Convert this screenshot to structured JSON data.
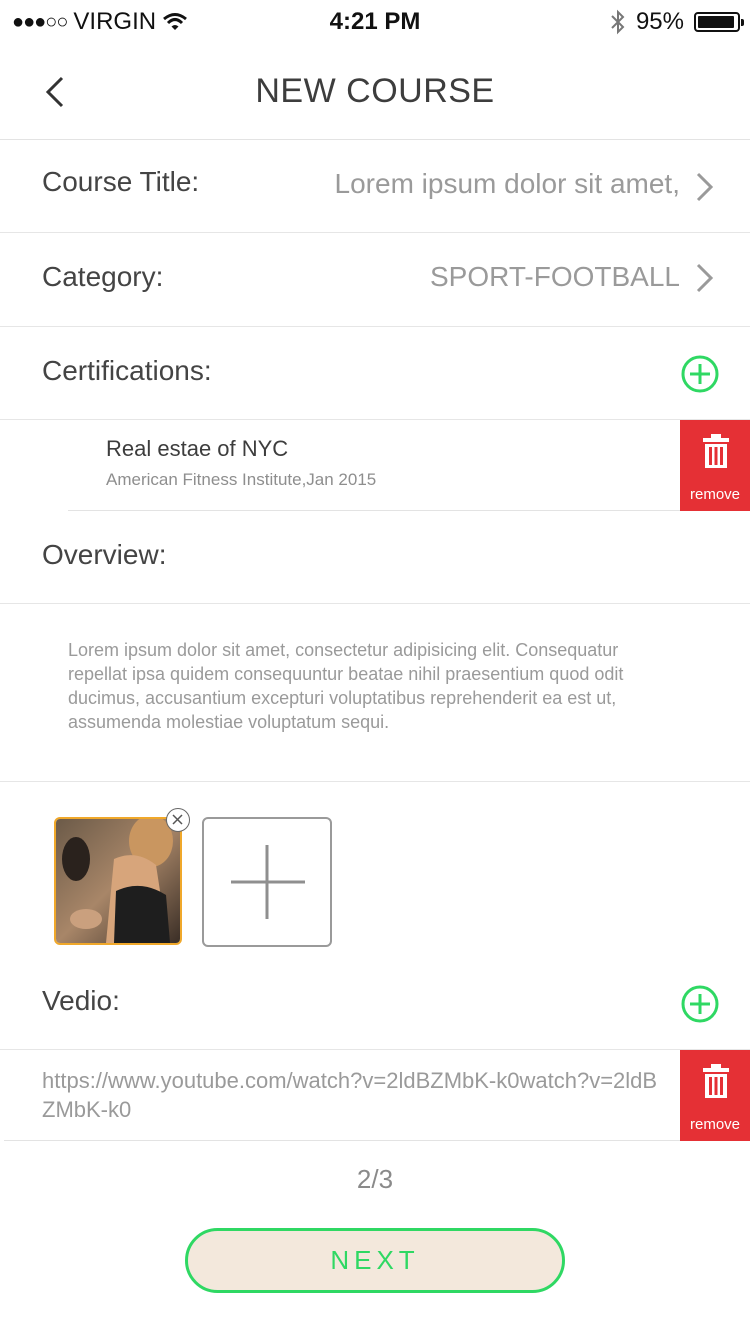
{
  "status_bar": {
    "carrier": "VIRGIN",
    "signal_dots": "●●●○○",
    "time": "4:21 PM",
    "battery_percent": "95%",
    "battery_level": 0.95
  },
  "nav": {
    "title": "NEW COURSE"
  },
  "form": {
    "course_title_label": "Course Title:",
    "course_title_value": "Lorem ipsum dolor sit amet,",
    "category_label": "Category:",
    "category_value": "SPORT-FOOTBALL",
    "certifications_label": "Certifications:",
    "certifications": [
      {
        "title": "Real estae of NYC",
        "subtitle": "American Fitness Institute,Jan 2015",
        "remove_label": "remove"
      }
    ],
    "overview_label": "Overview:",
    "overview_text": "Lorem ipsum dolor sit amet, consectetur adipisicing elit. Consequatur repellat ipsa quidem consequuntur beatae nihil praesentium quod odit ducimus, accusantium excepturi voluptatibus reprehenderit ea est ut, assumenda molestiae voluptatum sequi.",
    "video_label": "Vedio:",
    "videos": [
      {
        "url": "https://www.youtube.com/watch?v=2ldBZMbK-k0watch?v=2ldBZMbK-k0",
        "remove_label": "remove"
      }
    ]
  },
  "pager": {
    "text": "2/3"
  },
  "next_button": {
    "label": "NEXT"
  },
  "colors": {
    "accent_green": "#2fd863",
    "remove_red": "#e53035",
    "thumb_border": "#f0a82a",
    "next_bg": "#f3e8dc"
  },
  "icons": [
    "back-icon",
    "wifi-icon",
    "bluetooth-icon",
    "chevron-right-icon",
    "plus-circle-icon",
    "trash-icon",
    "close-icon",
    "plus-icon"
  ]
}
